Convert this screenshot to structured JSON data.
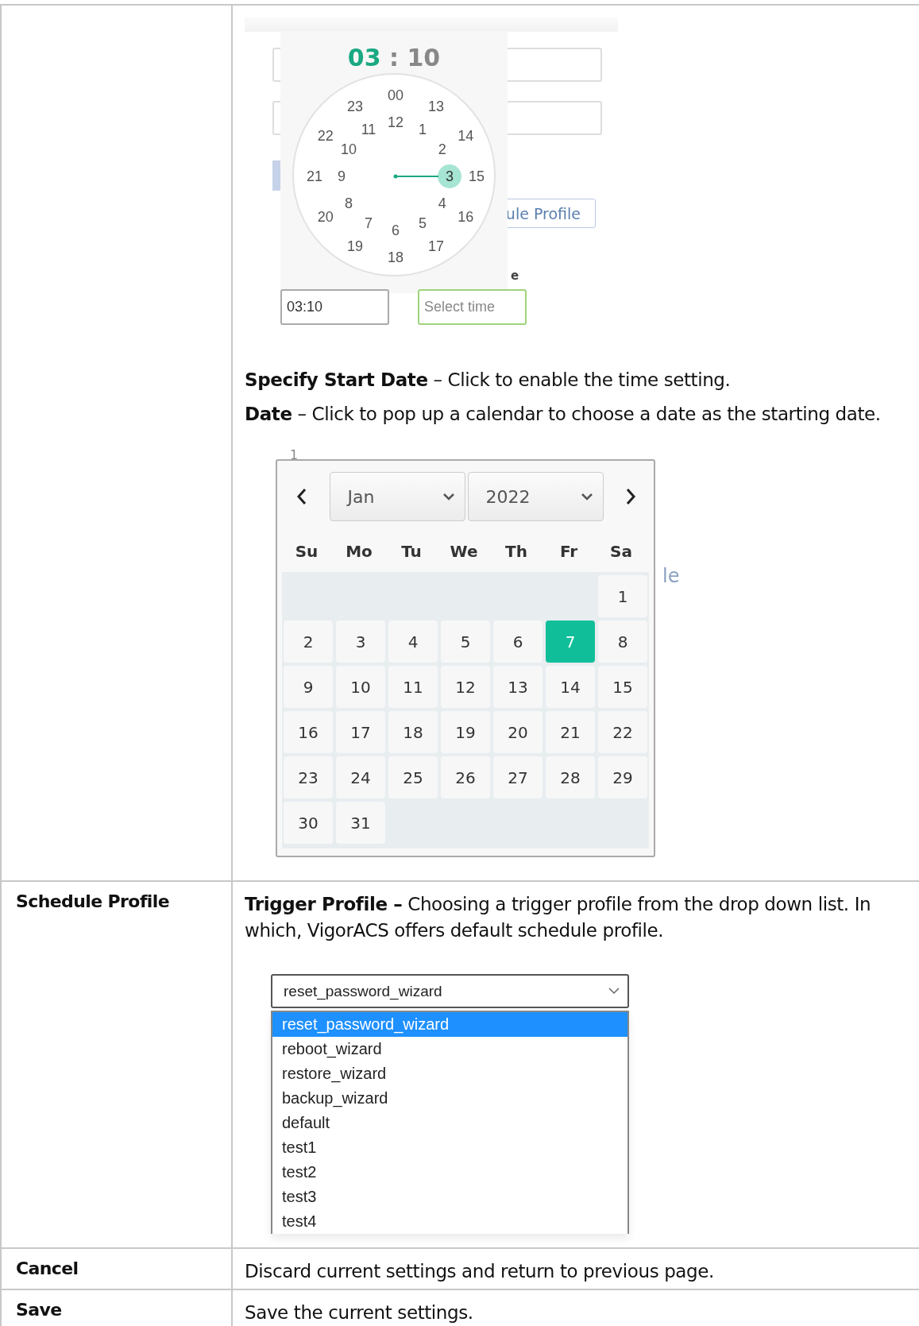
{
  "rows": [
    {
      "time_picker": {
        "background": {
          "button_fragment": "ule Profile",
          "label_fragment": "e"
        },
        "header": {
          "hours": "03",
          "separator": ":",
          "minutes": "10"
        },
        "outer_ring": [
          "00",
          "13",
          "14",
          "15",
          "16",
          "17",
          "18",
          "19",
          "20",
          "21",
          "22",
          "23"
        ],
        "inner_ring": [
          {
            "label": "12",
            "selected": false
          },
          {
            "label": "1",
            "selected": false
          },
          {
            "label": "2",
            "selected": false
          },
          {
            "label": "3",
            "selected": true
          },
          {
            "label": "4",
            "selected": false
          },
          {
            "label": "5",
            "selected": false
          },
          {
            "label": "6",
            "selected": false
          },
          {
            "label": "7",
            "selected": false
          },
          {
            "label": "8",
            "selected": false
          },
          {
            "label": "9",
            "selected": false
          },
          {
            "label": "10",
            "selected": false
          },
          {
            "label": "11",
            "selected": false
          }
        ],
        "value_field": {
          "value": "03:10"
        },
        "select_field": {
          "placeholder": "Select time"
        }
      },
      "paragraphs": [
        "**Specify Start Date** – Click to enable the time setting.",
        "**Date** – Click to pop up a calendar to choose a date as the starting date."
      ],
      "calendar": {
        "fragments": {
          "above": "1",
          "right": "le"
        },
        "month": "Jan",
        "year": "2022",
        "weekdays": [
          "Su",
          "Mo",
          "Tu",
          "We",
          "Th",
          "Fr",
          "Sa"
        ],
        "weeks": [
          {
            "kind": "leading",
            "days": [
              {
                "label": "1",
                "selected": false
              }
            ]
          },
          {
            "kind": "full",
            "days": [
              {
                "label": "2",
                "selected": false
              },
              {
                "label": "3",
                "selected": false
              },
              {
                "label": "4",
                "selected": false
              },
              {
                "label": "5",
                "selected": false
              },
              {
                "label": "6",
                "selected": false
              },
              {
                "label": "7",
                "selected": true
              },
              {
                "label": "8",
                "selected": false
              }
            ]
          },
          {
            "kind": "full",
            "days": [
              {
                "label": "9",
                "selected": false
              },
              {
                "label": "10",
                "selected": false
              },
              {
                "label": "11",
                "selected": false
              },
              {
                "label": "12",
                "selected": false
              },
              {
                "label": "13",
                "selected": false
              },
              {
                "label": "14",
                "selected": false
              },
              {
                "label": "15",
                "selected": false
              }
            ]
          },
          {
            "kind": "full",
            "days": [
              {
                "label": "16",
                "selected": false
              },
              {
                "label": "17",
                "selected": false
              },
              {
                "label": "18",
                "selected": false
              },
              {
                "label": "19",
                "selected": false
              },
              {
                "label": "20",
                "selected": false
              },
              {
                "label": "21",
                "selected": false
              },
              {
                "label": "22",
                "selected": false
              }
            ]
          },
          {
            "kind": "full",
            "days": [
              {
                "label": "23",
                "selected": false
              },
              {
                "label": "24",
                "selected": false
              },
              {
                "label": "25",
                "selected": false
              },
              {
                "label": "26",
                "selected": false
              },
              {
                "label": "27",
                "selected": false
              },
              {
                "label": "28",
                "selected": false
              },
              {
                "label": "29",
                "selected": false
              }
            ]
          },
          {
            "kind": "trailing",
            "days": [
              {
                "label": "30",
                "selected": false
              },
              {
                "label": "31",
                "selected": false
              }
            ]
          }
        ]
      }
    },
    {
      "label": "Schedule Profile",
      "paragraphs": [
        "**Trigger Profile –** Choosing a trigger profile from the drop down list. In which, VigorACS offers default schedule profile."
      ],
      "dropdown": {
        "value": "reset_password_wizard",
        "options": [
          {
            "label": "reset_password_wizard",
            "selected": true
          },
          {
            "label": "reboot_wizard",
            "selected": false
          },
          {
            "label": "restore_wizard",
            "selected": false
          },
          {
            "label": "backup_wizard",
            "selected": false
          },
          {
            "label": "default",
            "selected": false
          },
          {
            "label": "test1",
            "selected": false
          },
          {
            "label": "test2",
            "selected": false
          },
          {
            "label": "test3",
            "selected": false
          },
          {
            "label": "test4",
            "selected": false
          }
        ]
      }
    },
    {
      "label": "Cancel",
      "paragraphs": [
        "Discard current settings and return to previous page."
      ]
    },
    {
      "label": "Save",
      "paragraphs": [
        "Save the current settings."
      ]
    }
  ]
}
